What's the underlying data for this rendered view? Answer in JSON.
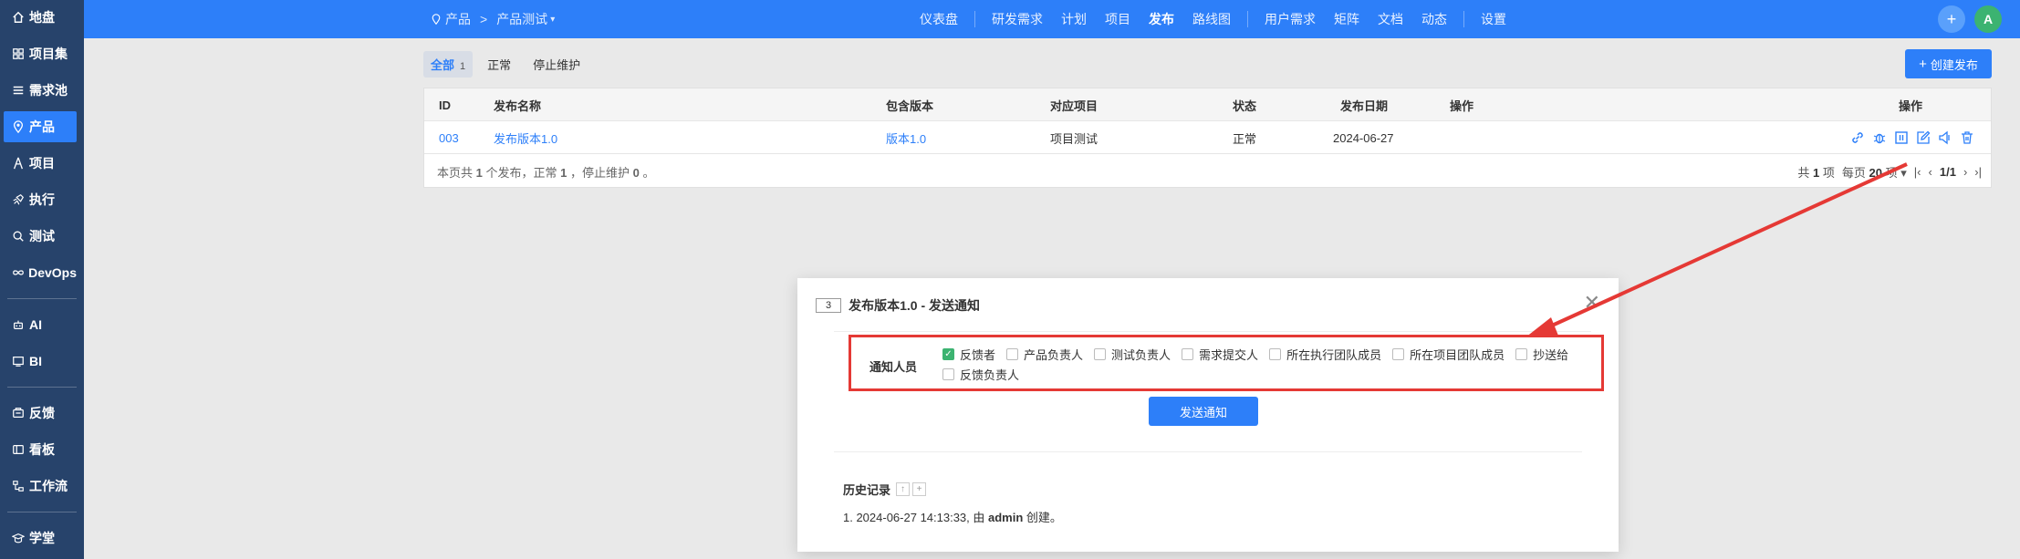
{
  "sidebar": {
    "items": [
      {
        "label": "地盘",
        "icon": "home-icon"
      },
      {
        "label": "项目集",
        "icon": "grid-icon"
      },
      {
        "label": "需求池",
        "icon": "list-icon"
      },
      {
        "label": "产品",
        "icon": "location-pin-icon",
        "active": true
      },
      {
        "label": "项目",
        "icon": "tower-icon"
      },
      {
        "label": "执行",
        "icon": "rocket-icon"
      },
      {
        "label": "测试",
        "icon": "search-bug-icon"
      },
      {
        "label": "DevOps",
        "icon": "infinity-icon"
      },
      {
        "label": "AI",
        "icon": "robot-icon"
      },
      {
        "label": "BI",
        "icon": "chart-icon"
      },
      {
        "label": "反馈",
        "icon": "feedback-icon"
      },
      {
        "label": "看板",
        "icon": "board-icon"
      },
      {
        "label": "工作流",
        "icon": "workflow-icon"
      },
      {
        "label": "学堂",
        "icon": "graduation-icon"
      }
    ]
  },
  "topbar": {
    "breadcrumb": {
      "root": "产品",
      "current": "产品测试"
    },
    "nav": [
      {
        "label": "仪表盘"
      },
      {
        "label": "研发需求"
      },
      {
        "label": "计划"
      },
      {
        "label": "项目"
      },
      {
        "label": "发布",
        "active": true
      },
      {
        "label": "路线图"
      },
      {
        "label": "用户需求"
      },
      {
        "label": "矩阵"
      },
      {
        "label": "文档"
      },
      {
        "label": "动态"
      },
      {
        "label": "设置"
      }
    ],
    "avatar_letter": "A"
  },
  "filters": {
    "all_label": "全部",
    "all_count": "1",
    "normal_label": "正常",
    "stopped_label": "停止维护"
  },
  "create_button": "创建发布",
  "table": {
    "headers": {
      "id": "ID",
      "name": "发布名称",
      "build": "包含版本",
      "project": "对应项目",
      "status": "状态",
      "date": "发布日期",
      "action": "操作",
      "ops": "操作"
    },
    "row": {
      "id": "003",
      "name": "发布版本1.0",
      "build": "版本1.0",
      "project": "项目测试",
      "status": "正常",
      "date": "2024-06-27"
    },
    "summary": {
      "prefix": "本页共",
      "total": "1",
      "mid1": "个发布，正常",
      "normal": "1",
      "mid2": "，停止维护",
      "stopped": "0",
      "suffix": "。"
    },
    "pager": {
      "total_prefix": "共",
      "total": "1",
      "total_suffix": "项",
      "per_prefix": "每页",
      "per_page": "20",
      "per_suffix": "项",
      "page": "1/1"
    }
  },
  "modal": {
    "id": "3",
    "title": "发布版本1.0 - 发送通知",
    "notify_label": "通知人员",
    "options": [
      {
        "label": "反馈者",
        "checked": true
      },
      {
        "label": "产品负责人",
        "checked": false
      },
      {
        "label": "测试负责人",
        "checked": false
      },
      {
        "label": "需求提交人",
        "checked": false
      },
      {
        "label": "所在执行团队成员",
        "checked": false
      },
      {
        "label": "所在项目团队成员",
        "checked": false
      },
      {
        "label": "抄送给",
        "checked": false
      },
      {
        "label": "反馈负责人",
        "checked": false
      }
    ],
    "send_button": "发送通知",
    "history_title": "历史记录",
    "history_entry": {
      "prefix": "1. 2024-06-27 14:13:33, 由 ",
      "user": "admin",
      "suffix": " 创建。"
    }
  },
  "colors": {
    "accent": "#2d7ff9",
    "sidebar": "#27436b",
    "highlight": "#e53935",
    "checked": "#3cb371"
  }
}
